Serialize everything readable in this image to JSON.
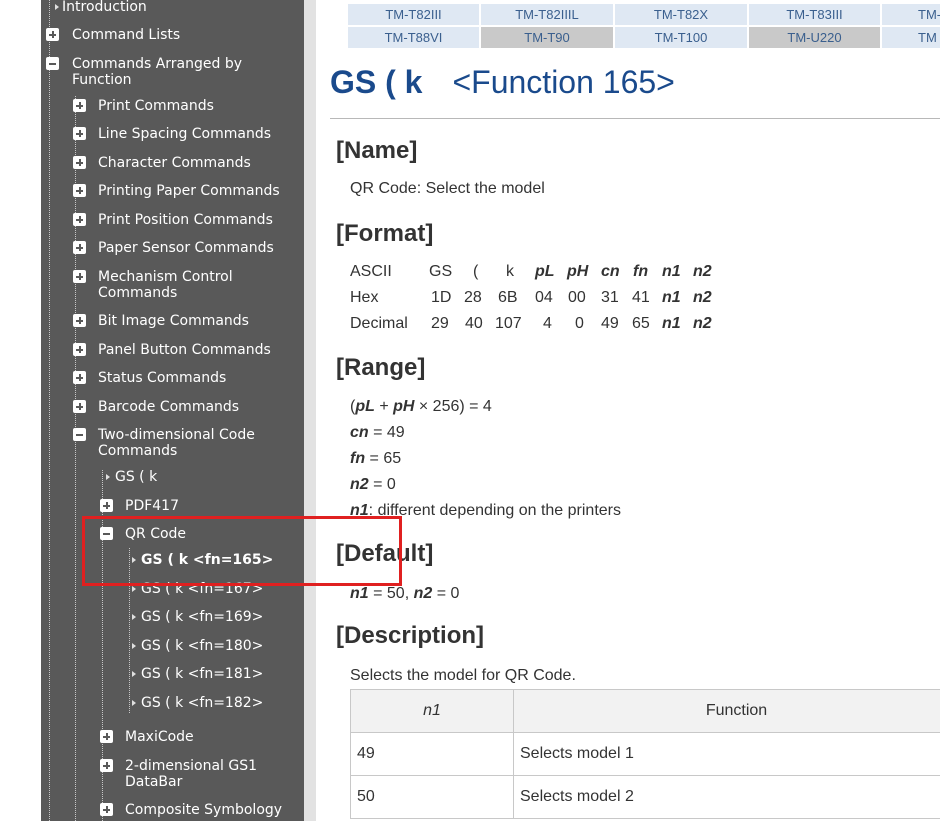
{
  "sidebar": {
    "introduction": "Introduction",
    "command_lists": "Command Lists",
    "commands_by_function": "Commands Arranged by Function",
    "groups": [
      "Print Commands",
      "Line Spacing Commands",
      "Character Commands",
      "Printing Paper Commands",
      "Print Position Commands",
      "Paper Sensor Commands",
      "Mechanism Control Commands",
      "Bit Image Commands",
      "Panel Button Commands",
      "Status Commands",
      "Barcode Commands"
    ],
    "two_dim": "Two-dimensional Code Commands",
    "gs_k": "GS ( k",
    "pdf417": "PDF417",
    "qr_code": "QR Code",
    "qr_items": [
      "GS ( k <fn=165>",
      "GS ( k <fn=167>",
      "GS ( k <fn=169>",
      "GS ( k <fn=180>",
      "GS ( k <fn=181>",
      "GS ( k <fn=182>"
    ],
    "maxicode": "MaxiCode",
    "gs1": "2-dimensional GS1 DataBar",
    "composite": "Composite Symbology"
  },
  "models": {
    "row1": [
      "TM-T82III",
      "TM-T82IIIL",
      "TM-T82X",
      "TM-T83III",
      "TM-"
    ],
    "row2": [
      "TM-T88VI",
      "TM-T90",
      "TM-T100",
      "TM-U220",
      "TM"
    ]
  },
  "page": {
    "command": "GS ( k",
    "function": "<Function 165>",
    "name_heading": "[Name]",
    "name_text": "QR Code: Select the model",
    "format_heading": "[Format]",
    "format": {
      "ascii": [
        "ASCII",
        "GS",
        "(",
        "k",
        "pL",
        "pH",
        "cn",
        "fn",
        "n1",
        "n2"
      ],
      "hex": [
        "Hex",
        "1D",
        "28",
        "6B",
        "04",
        "00",
        "31",
        "41",
        "n1",
        "n2"
      ],
      "decimal": [
        "Decimal",
        "29",
        "40",
        "107",
        "4",
        "0",
        "49",
        "65",
        "n1",
        "n2"
      ]
    },
    "range_heading": "[Range]",
    "range": {
      "l1_open": "(",
      "l1_pl": "pL",
      "l1_plus": " + ",
      "l1_ph": "pH",
      "l1_rest": " × 256) = 4",
      "cn": "cn",
      "cn_val": " = 49",
      "fn": "fn",
      "fn_val": " = 65",
      "n2": "n2",
      "n2_val": " = 0",
      "n1": "n1",
      "n1_val": ": different depending on the printers"
    },
    "default_heading": "[Default]",
    "default": {
      "n1": "n1",
      "n1_val": " = 50, ",
      "n2": "n2",
      "n2_val": " = 0"
    },
    "description_heading": "[Description]",
    "description_text": "Selects the model for QR Code.",
    "table": {
      "headers": [
        "n1",
        "Function"
      ],
      "rows": [
        [
          "49",
          "Selects model 1"
        ],
        [
          "50",
          "Selects model 2"
        ]
      ]
    }
  },
  "colors": {
    "sidebar_bg": "#595959",
    "title_blue": "#1a4a8c",
    "highlight_red": "#e02020"
  }
}
